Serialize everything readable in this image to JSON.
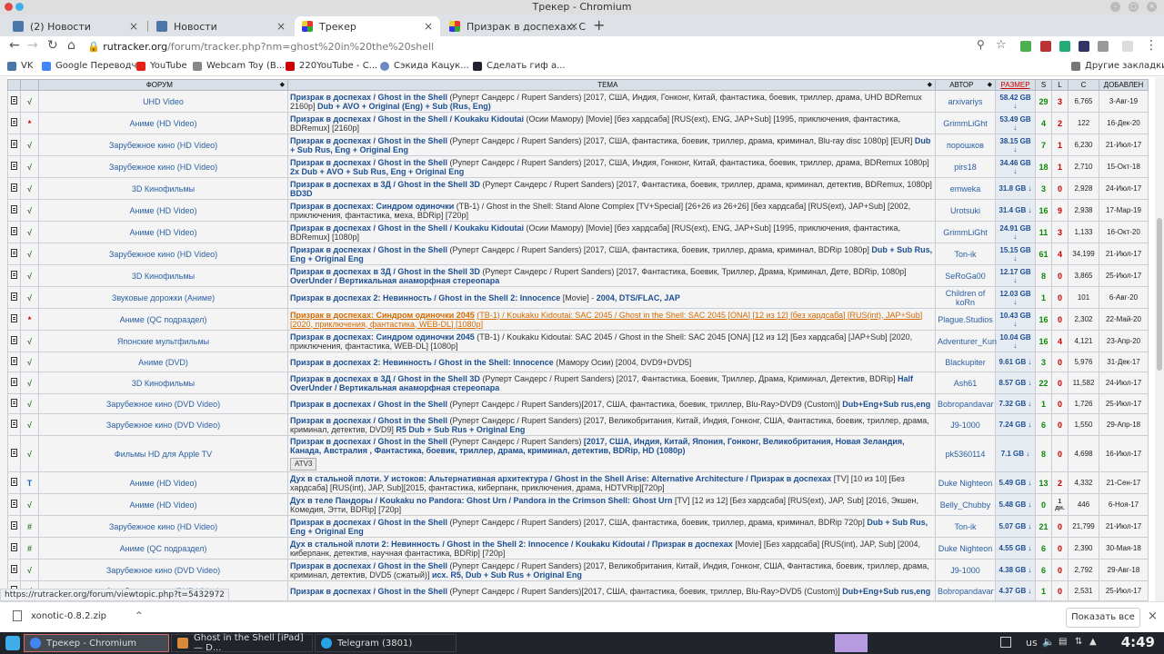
{
  "window": {
    "title": "Трекер - Chromium"
  },
  "tabs": [
    {
      "label": "(2) Новости",
      "icon": "vk-icon"
    },
    {
      "label": "Новости",
      "icon": "vk-icon"
    },
    {
      "label": "Трекер",
      "icon": "rutracker-icon"
    },
    {
      "label": "Призрак в доспехах: Син",
      "icon": "rutracker-icon"
    }
  ],
  "address": {
    "host": "rutracker.org",
    "path": "/forum/tracker.php?nm=ghost%20in%20the%20shell"
  },
  "bookmarks": [
    "VK",
    "Google Переводч...",
    "YouTube",
    "Webcam Toy (B...",
    "220YouTube - С...",
    "Сэкида Кацук...",
    "Сделать гиф а..."
  ],
  "bookmarks_other": "Другие закладки",
  "table": {
    "headers": {
      "forum": "ФОРУМ",
      "topic": "ТЕМА",
      "author": "АВТОР",
      "size": "РАЗМЕР",
      "seeds": "S",
      "leech": "L",
      "compl": "C",
      "added": "ДОБАВЛЕН"
    },
    "rows": [
      {
        "status": "√",
        "forum": "UHD Video",
        "title": "Призрак в доспехах / Ghost in the Shell",
        "info": "(Рупepт Сандерс / Rupert Sanders) [2017, США, Индия, Гонконг, Китай, фантастика, боевик, триллер, драма, UHD BDRemux 2160p]",
        "extra": "Dub + AVO + Original (Eng) + Sub (Rus, Eng)",
        "author": "arxivariys",
        "size": "58.42 GB ↓",
        "seeds": "29",
        "leech": "3",
        "compl": "6,765",
        "date": "3-Авг-19"
      },
      {
        "status": "*",
        "forum": "Аниме (HD Video)",
        "title": "Призрак в доспехах / Ghost in the Shell / Koukaku Kidoutai",
        "info": "(Осии Мамору) [Movie] [без хардсаба] [RUS(ext), ENG, JAP+Sub] [1995, приключения, фантастика, BDRemux] [2160p]",
        "extra": "",
        "author": "GrimmLiGht",
        "size": "53.49 GB ↓",
        "seeds": "4",
        "leech": "2",
        "compl": "122",
        "date": "16-Дек-20"
      },
      {
        "status": "√",
        "forum": "Зарубежное кино (HD Video)",
        "title": "Призрак в доспехах / Ghost in the Shell",
        "info": "(Рупepт Сандерс / Rupert Sanders) [2017, США, фантастика, боевик, триллер, драма, криминал, Blu-ray disc 1080p] [EUR]",
        "extra": "Dub + Sub Rus, Eng + Original Eng",
        "author": "порошков",
        "size": "38.15 GB ↓",
        "seeds": "7",
        "leech": "1",
        "compl": "6,230",
        "date": "21-Июл-17"
      },
      {
        "status": "√",
        "forum": "Зарубежное кино (HD Video)",
        "title": "Призрак в доспехах / Ghost in the Shell",
        "info": "(Рупepт Сандерс / Rupert Sanders) [2017, США, Индия, Гонконг, Китай, фантастика, боевик, триллер, драма, BDRemux 1080p]",
        "extra": "2x Dub + AVO + Sub Rus, Eng + Original Eng",
        "author": "pirs18",
        "size": "34.46 GB ↓",
        "seeds": "18",
        "leech": "1",
        "compl": "2,710",
        "date": "15-Окт-18"
      },
      {
        "status": "√",
        "forum": "3D Кинофильмы",
        "title": "Призрак в доспехах в 3Д / Ghost in the Shell 3D",
        "info": "(Рупepт Сандерс / Rupert Sanders) [2017, Фантастика, боевик, триллер, драма, криминал, детектив, BDRemux, 1080p]",
        "extra": "BD3D",
        "author": "emweka",
        "size": "31.8 GB ↓",
        "seeds": "3",
        "leech": "0",
        "compl": "2,928",
        "date": "24-Июл-17"
      },
      {
        "status": "√",
        "forum": "Аниме (HD Video)",
        "title": "Призрак в доспехах: Синдром одиночки",
        "info": "(ТВ-1) / Ghost in the Shell: Stand Alone Complex [TV+Special] [26+26 из 26+26] [без хардсаба] [RUS(ext), JAP+Sub] [2002, приключения, фантастика, меха, BDRip] [720p]",
        "extra": "",
        "author": "Urotsuki",
        "size": "31.4 GB ↓",
        "seeds": "16",
        "leech": "9",
        "compl": "2,938",
        "date": "17-Мар-19"
      },
      {
        "status": "√",
        "forum": "Аниме (HD Video)",
        "title": "Призрак в доспехах / Ghost in the Shell / Koukaku Kidoutai",
        "info": "(Осии Мамору) [Movie] [без хардсаба] [RUS(ext), ENG, JAP+Sub] [1995, приключения, фантастика, BDRemux] [1080p]",
        "extra": "",
        "author": "GrimmLiGht",
        "size": "24.91 GB ↓",
        "seeds": "11",
        "leech": "3",
        "compl": "1,133",
        "date": "16-Окт-20"
      },
      {
        "status": "√",
        "forum": "Зарубежное кино (HD Video)",
        "title": "Призрак в доспехах / Ghost in the Shell",
        "info": "(Рупepт Сандерс / Rupert Sanders) [2017, США, фантастика, боевик, триллер, драма, криминал, BDRip 1080p]",
        "extra": "Dub + Sub Rus, Eng + Original Eng",
        "author": "Ton-ik",
        "size": "15.15 GB ↓",
        "seeds": "61",
        "leech": "4",
        "compl": "34,199",
        "date": "21-Июл-17"
      },
      {
        "status": "√",
        "forum": "3D Кинофильмы",
        "title": "Призрак в доспехах в 3Д / Ghost in the Shell 3D",
        "info": "(Рупepт Сандерс / Rupert Sanders) [2017, Фантастика, Боевик, Триллер, Драма, Криминал, Детe, BDRip, 1080p]",
        "extra": "OverUnder / Вертикальная анаморфная стереопара",
        "author": "SeRoGa00",
        "size": "12.17 GB ↓",
        "seeds": "8",
        "leech": "0",
        "compl": "3,865",
        "date": "25-Июл-17"
      },
      {
        "status": "√",
        "forum": "Звуковые дорожки (Аниме)",
        "title": "Призрак в доспехах 2: Невинность / Ghost in the Shell 2: Innocence",
        "info": "[Movie] -",
        "extra": "2004, DTS/FLAC, JAP",
        "author": "Children of koRn",
        "size": "12.03 GB ↓",
        "seeds": "1",
        "leech": "0",
        "compl": "101",
        "date": "6-Авг-20"
      },
      {
        "status": "*",
        "forum": "Аниме (QC подраздел)",
        "title": "Призрак в доспехах: Синдром одиночки 2045",
        "info": "(ТВ-1) / Koukaku Kidoutai: SAC 2045 / Ghost in the Shell: SAC 2045 [ONA] [12 из 12] [без хардсаба] [RUS(int), JAP+Sub] [2020, приключения, фантастика, WEB-DL] [1080p]",
        "extra": "",
        "author": "Plague.Studios",
        "size": "10.43 GB ↓",
        "seeds": "16",
        "leech": "0",
        "compl": "2,302",
        "date": "22-Май-20",
        "hover": true
      },
      {
        "status": "√",
        "forum": "Японские мультфильмы",
        "title": "Призрак в доспехах: Синдром одиночки 2045",
        "info": "(ТВ-1) / Koukaku Kidoutai: SAC 2045 / Ghost in the Shell: SAC 2045 [ONA] [12 из 12] [Без хардсаба] [JAP+Sub] [2020, приключения, фантастика, WEB-DL] [1080p]",
        "extra": "",
        "author": "Adventurer_Kun",
        "size": "10.04 GB ↓",
        "seeds": "16",
        "leech": "4",
        "compl": "4,121",
        "date": "23-Апр-20"
      },
      {
        "status": "√",
        "forum": "Аниме (DVD)",
        "title": "Призрак в доспехах 2: Невинность / Ghost in the Shell: Innocence",
        "info": "(Мамору Осии) [2004, DVD9+DVD5]",
        "extra": "",
        "author": "Blackupiter",
        "size": "9.61 GB ↓",
        "seeds": "3",
        "leech": "0",
        "compl": "5,976",
        "date": "31-Дек-17"
      },
      {
        "status": "√",
        "forum": "3D Кинофильмы",
        "title": "Призрак в доспехах в 3Д / Ghost in the Shell 3D",
        "info": "(Рупepт Сандерс / Rupert Sanders) [2017, Фантастика, Боевик, Триллер, Драма, Криминал, Детектив, BDRip]",
        "extra": "Half OverUnder / Вертикальная анаморфная стереопара",
        "author": "Ash61",
        "size": "8.57 GB ↓",
        "seeds": "22",
        "leech": "0",
        "compl": "11,582",
        "date": "24-Июл-17"
      },
      {
        "status": "√",
        "forum": "Зарубежное кино (DVD Video)",
        "title": "Призрак в доспехах / Ghost in the Shell",
        "info": "(Рупepт Сандерс / Rupert Sanders)[2017, США, фантастика, боевик, триллер, Blu-Ray>DVD9 (Custom)]",
        "extra": "Dub+Eng+Sub rus,eng",
        "author": "Bobropandavar",
        "size": "7.32 GB ↓",
        "seeds": "1",
        "leech": "0",
        "compl": "1,726",
        "date": "25-Июл-17"
      },
      {
        "status": "√",
        "forum": "Зарубежное кино (DVD Video)",
        "title": "Призрак в доспехах / Ghost in the Shell",
        "info": "(Рупepт Сандерс / Rupert Sanders) [2017, Великобритания, Китай, Индия, Гонконг, США, Фантастика, боевик, триллер, драма, криминал, детектив, DVD9]",
        "extra": "R5 Dub + Sub Rus + Original Eng",
        "author": "J9-1000",
        "size": "7.24 GB ↓",
        "seeds": "6",
        "leech": "0",
        "compl": "1,550",
        "date": "29-Апр-18"
      },
      {
        "status": "√",
        "forum": "Фильмы HD для Apple TV",
        "title": "Призрак в доспехах / Ghost in the Shell",
        "info": "(Рупepт Сандерс / Rupert Sanders)",
        "extra": "[2017, США, Индия, Китай, Япония, Гонконг, Великобритания, Новая Зеландия, Канада, Австралия , Фантастика, боевик, триллер, драма, криминал, детектив, BDRip, HD (1080p)",
        "tag": "ATV3",
        "author": "pk5360114",
        "size": "7.1 GB ↓",
        "seeds": "8",
        "leech": "0",
        "compl": "4,698",
        "date": "16-Июл-17"
      },
      {
        "status": "T",
        "forum": "Аниме (HD Video)",
        "title": "Дух в стальной плоти. У истоков: Альтернативная архитектура / Ghost in the Shell Arise: Alternative Architecture / Призрак в доспехах",
        "info": "[TV] [10 из 10] [Без хардсаба] [RUS(int), JAP, Sub][2015, фантастика, киберпанк, приключения, драма, HDTVRip][720p]",
        "extra": "",
        "author": "Duke Nighteon",
        "size": "5.49 GB ↓",
        "seeds": "13",
        "leech": "2",
        "compl": "4,332",
        "date": "21-Сен-17"
      },
      {
        "status": "√",
        "forum": "Аниме (HD Video)",
        "title": "Дух в теле Пандоры / Koukaku no Pandora: Ghost Urn / Pandora in the Crimson Shell: Ghost Urn",
        "info": "[TV] [12 из 12] [Без хардсаба] [RUS(ext), JAP, Sub] [2016, Экшен, Комедия, Этти, BDRip] [720p]",
        "extra": "",
        "author": "Belly_Chubby",
        "size": "5.48 GB ↓",
        "seeds": "0",
        "leech": "1 дн.",
        "compl": "446",
        "date": "6-Ноя-17"
      },
      {
        "status": "#",
        "forum": "Зарубежное кино (HD Video)",
        "title": "Призрак в доспехах / Ghost in the Shell",
        "info": "(Рупepт Сандерс / Rupert Sanders) [2017, США, фантастика, боевик, триллер, драма, криминал, BDRip 720p]",
        "extra": "Dub + Sub Rus, Eng + Original Eng",
        "author": "Ton-ik",
        "size": "5.07 GB ↓",
        "seeds": "21",
        "leech": "0",
        "compl": "21,799",
        "date": "21-Июл-17"
      },
      {
        "status": "#",
        "forum": "Аниме (QC подраздел)",
        "title": "Дух в стальной плоти 2: Невинность / Ghost in the Shell 2: Innocence / Koukaku Kidoutai / Призрак в доспехах",
        "info": "[Movie] [Без хардсаба] [RUS(int), JAP, Sub] [2004, киберпанк, детектив, научная фантастика, BDRip] [720p]",
        "extra": "",
        "author": "Duke Nighteon",
        "size": "4.55 GB ↓",
        "seeds": "6",
        "leech": "0",
        "compl": "2,390",
        "date": "30-Мая-18"
      },
      {
        "status": "√",
        "forum": "Зарубежное кино (DVD Video)",
        "title": "Призрак в доспехах / Ghost in the Shell",
        "info": "(Рупepт Сандерс / Rupert Sanders) [2017, Великобритания, Китай, Индия, Гонконг, США, Фантастика, боевик, триллер, драма, криминал, детектив, DVD5 (сжатый)]",
        "extra": "исх. R5, Dub + Sub Rus + Original Eng",
        "author": "J9-1000",
        "size": "4.38 GB ↓",
        "seeds": "6",
        "leech": "0",
        "compl": "2,792",
        "date": "29-Авг-18"
      },
      {
        "status": "√",
        "forum": "Зарубежное кино (DVD Video)",
        "title": "Призрак в доспехах / Ghost in the Shell",
        "info": "(Рупepт Сандерс / Rupert Sanders)[2017, США, фантастика, боевик, триллер, Blu-Ray>DVD5 (Custom)]",
        "extra": "Dub+Eng+Sub rus,eng",
        "author": "Bobropandavar",
        "size": "4.37 GB ↓",
        "seeds": "1",
        "leech": "0",
        "compl": "2,531",
        "date": "25-Июл-17"
      }
    ]
  },
  "status_link": "https://rutracker.org/forum/viewtopic.php?t=5432972",
  "download": {
    "file": "xonotic-0.8.2.zip",
    "show_all": "Показать все"
  },
  "taskbar": {
    "tasks": [
      "Трекер - Chromium",
      "Ghost in the Shell [iPad] — D...",
      "Telegram (3801)"
    ],
    "lang": "us",
    "clock": "4:49"
  },
  "colors": {
    "accent": "#1d4f93",
    "header": "#d9dfe6",
    "hover_title": "#d46a00"
  }
}
